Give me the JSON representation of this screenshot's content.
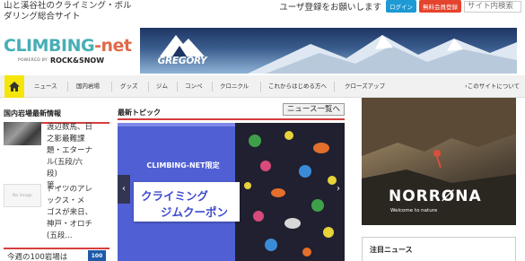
{
  "header": {
    "tagline": "山と溪谷社のクライミング・ボルダリング総合サイト",
    "register_message": "ユーザ登録をお願いします",
    "login_label": "ログイン",
    "register_label": "無料会員登録",
    "search_placeholder": "サイト内検索"
  },
  "logo": {
    "part1": "CLIMBING",
    "part2": "-net",
    "powered_by": "POWERED BY",
    "brand": "ROCK&SNOW"
  },
  "banner": {
    "brand": "GREGORY"
  },
  "nav": {
    "items": [
      "ニュース",
      "国内岩場",
      "グッズ",
      "ジム",
      "コンペ",
      "クロニクル",
      "これからはじめる方へ",
      "クローズアップ"
    ],
    "about": "›このサイトについて"
  },
  "left": {
    "heading": "国内岩場最新情報",
    "items": [
      {
        "text": [
          "渡辺数馬、日",
          "之影最難課",
          "題・エターナ",
          "ル(五段/六",
          "段)",
          "第..."
        ]
      },
      {
        "no_image": "No Image",
        "text": [
          "ドイツのアレ",
          "ックス・メ",
          "ゴスが来日、",
          "神戸・オロチ",
          "(五段..."
        ]
      }
    ],
    "bottom_teaser": "今週の100岩場は",
    "bottom_badge": "100"
  },
  "middle": {
    "heading": "最新トピック",
    "more_button": "ニュース一覧へ",
    "slide": {
      "kicker": "CLIMBING-NET限定",
      "line1": "クライミング",
      "line2": "ジムクーポン"
    }
  },
  "right": {
    "ad_brand": "NORRØNA",
    "ad_slogan": "Welcome to nature",
    "news_heading": "注目ニュース"
  },
  "colors": {
    "accent_red": "#d63d3d",
    "logo_teal": "#47aeb6",
    "logo_orange": "#e06a4a",
    "home_yellow": "#f5e50a",
    "slide_blue": "#5060d4"
  }
}
